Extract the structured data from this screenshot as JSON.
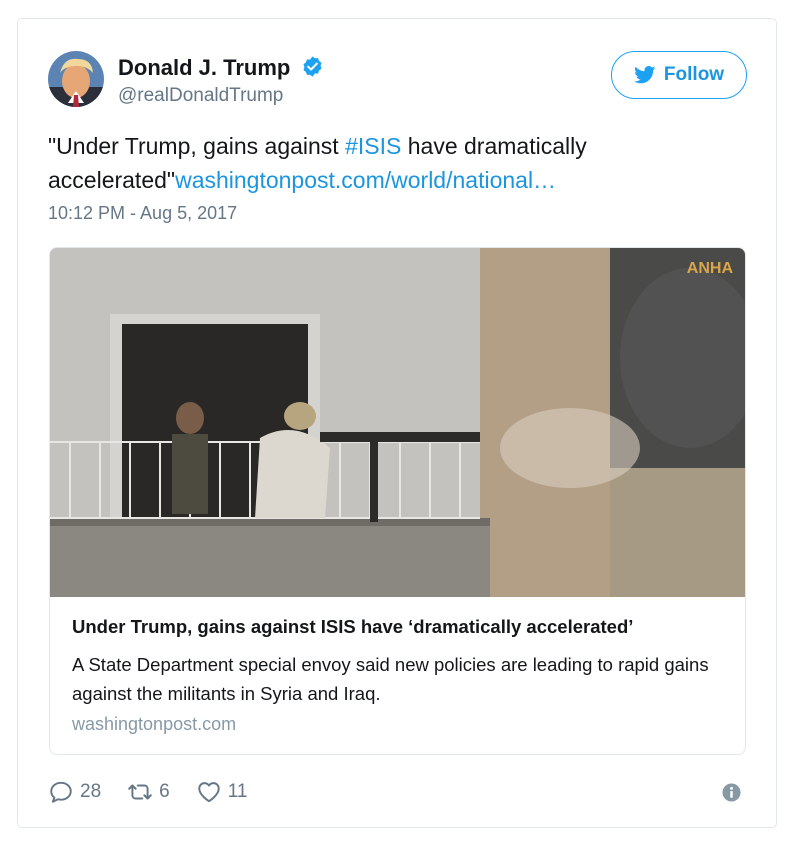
{
  "user": {
    "display_name": "Donald J. Trump",
    "handle": "@realDonaldTrump",
    "verified": true,
    "avatar_icon": "profile-photo"
  },
  "follow_button": {
    "label": "Follow",
    "icon": "twitter-bird-icon"
  },
  "tweet": {
    "text_before": "\"Under Trump, gains against ",
    "hashtag": "#ISIS",
    "text_middle": " have dramatically accelerated\"",
    "link_text": "washingtonpost.com/world/national…",
    "timestamp": "10:12 PM - Aug 5, 2017"
  },
  "card": {
    "watermark": "ANHA",
    "title": "Under Trump, gains against ISIS have ‘dramatically accelerated’",
    "description": "A State Department special envoy said new policies are leading to rapid gains against the militants in Syria and Iraq.",
    "domain": "washingtonpost.com"
  },
  "actions": {
    "replies": "28",
    "retweets": "6",
    "likes": "11"
  },
  "colors": {
    "link": "#1b95e0",
    "accent": "#1da1f2",
    "muted": "#657786",
    "border": "#e1e8ed"
  }
}
